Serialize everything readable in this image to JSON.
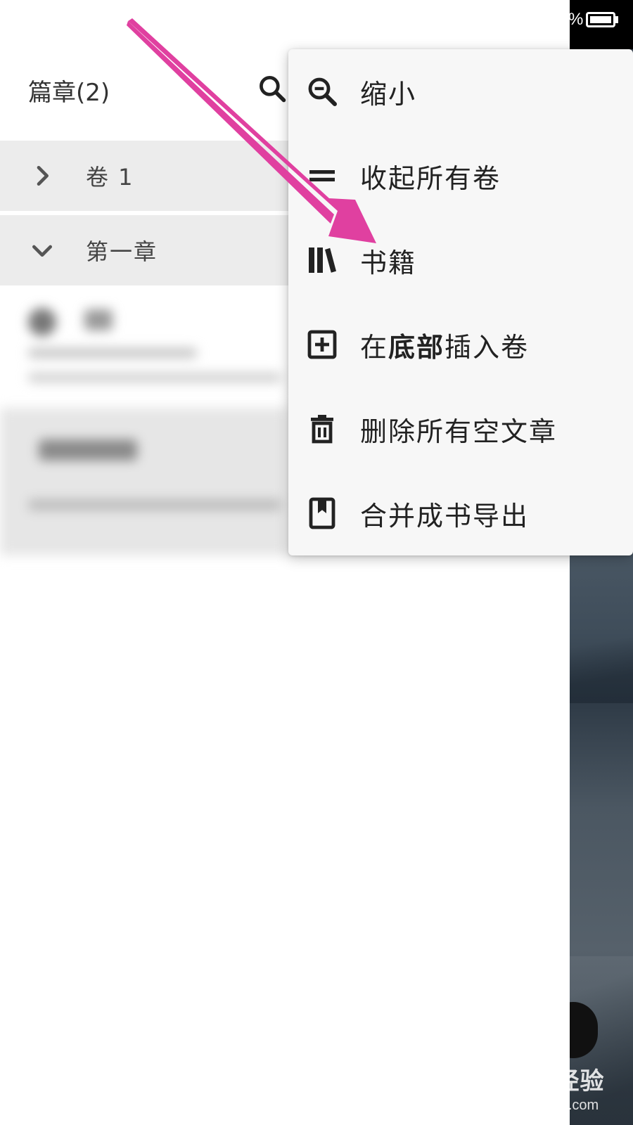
{
  "status_bar": {
    "battery_suffix": "%"
  },
  "drawer": {
    "title": "篇章(2)",
    "rows": [
      {
        "label": "卷 1",
        "icon": "chevron-right-icon"
      },
      {
        "label": "第一章",
        "icon": "chevron-down-icon"
      }
    ]
  },
  "menu": {
    "items": [
      {
        "name": "zoom-out",
        "label": "缩小",
        "icon": "zoom-out-icon"
      },
      {
        "name": "collapse-all",
        "label": "收起所有卷",
        "icon": "collapse-icon"
      },
      {
        "name": "books",
        "label": "书籍",
        "icon": "books-icon"
      },
      {
        "name": "insert-volume",
        "label_pre": "在",
        "label_bold": "底部",
        "label_post": "插入卷",
        "icon": "add-box-icon"
      },
      {
        "name": "delete-empty",
        "label": "删除所有空文章",
        "icon": "trash-icon"
      },
      {
        "name": "merge-export",
        "label": "合并成书导出",
        "icon": "bookmark-book-icon"
      }
    ]
  },
  "watermark": {
    "main": "Baidu经验",
    "sub": "jingyan.baidu.com"
  },
  "colors": {
    "annotation_arrow": "#e040a0",
    "menu_bg": "#f7f7f7",
    "row_bg": "#ececec"
  }
}
